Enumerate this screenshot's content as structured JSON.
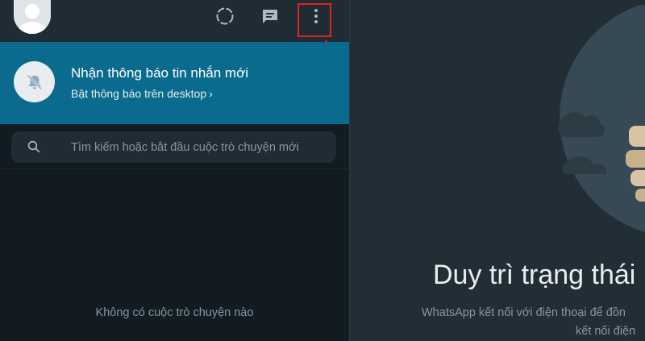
{
  "header": {
    "avatar_icon": "default-avatar-icon",
    "status_icon": "status-ring-icon",
    "new_chat_icon": "chat-bubble-icon",
    "menu_icon": "vertical-dots-menu-icon"
  },
  "annotation": {
    "highlight_color": "#e3202a"
  },
  "notification_banner": {
    "icon": "bell-off-icon",
    "title": "Nhận thông báo tin nhắn mới",
    "subtitle": "Bật thông báo trên desktop",
    "subtitle_chevron": "›",
    "background_color": "#0a6b8f"
  },
  "search": {
    "icon": "search-icon",
    "placeholder": "Tìm kiếm hoặc bắt đầu cuộc trò chuyện mới"
  },
  "chat_list": {
    "empty_text": "Không có cuộc trò chuyện nào"
  },
  "welcome": {
    "title": "Duy trì trạng thái",
    "description_line1": "WhatsApp kết nối với điện thoại để đồn",
    "description_line2": "kết nối điện"
  }
}
